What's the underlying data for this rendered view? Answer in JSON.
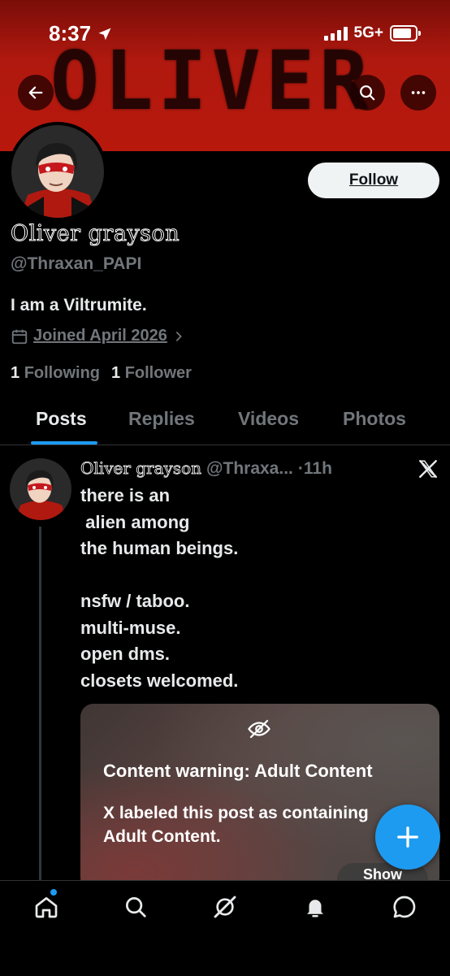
{
  "status_bar": {
    "time": "8:37",
    "network": "5G+"
  },
  "banner": {
    "text": "OLIVER"
  },
  "header_buttons": {
    "back_icon": "arrow-left-icon",
    "search_icon": "search-icon",
    "more_icon": "more-horizontal-icon"
  },
  "profile": {
    "display_name": "Oliver grayson",
    "handle": "@Thraxan_PAPI",
    "bio": "I am a Viltrumite.",
    "joined": "Joined April 2026",
    "following_count": "1",
    "following_label": "Following",
    "followers_count": "1",
    "followers_label": "Follower",
    "follow_button": "Follow"
  },
  "tabs": [
    {
      "label": "Posts",
      "active": true
    },
    {
      "label": "Replies",
      "active": false
    },
    {
      "label": "Videos",
      "active": false
    },
    {
      "label": "Photos",
      "active": false
    }
  ],
  "post": {
    "author": "Oliver grayson",
    "handle": "@Thraxa...",
    "time": "·11h",
    "text": "there is an\n alien among\nthe human beings.\n\nnsfw / taboo.\nmulti-muse.\nopen dms.\nclosets welcomed.",
    "content_warning": {
      "title": "Content warning: Adult Content",
      "body": "X labeled this post as containing Adult Content.",
      "show_button": "Show"
    }
  },
  "colors": {
    "accent": "#1d9bf0",
    "banner_red": "#b0190f",
    "text_secondary": "#71767b"
  },
  "bottom_nav": [
    "home-icon",
    "search-icon",
    "grok-icon",
    "notifications-icon",
    "messages-icon"
  ]
}
